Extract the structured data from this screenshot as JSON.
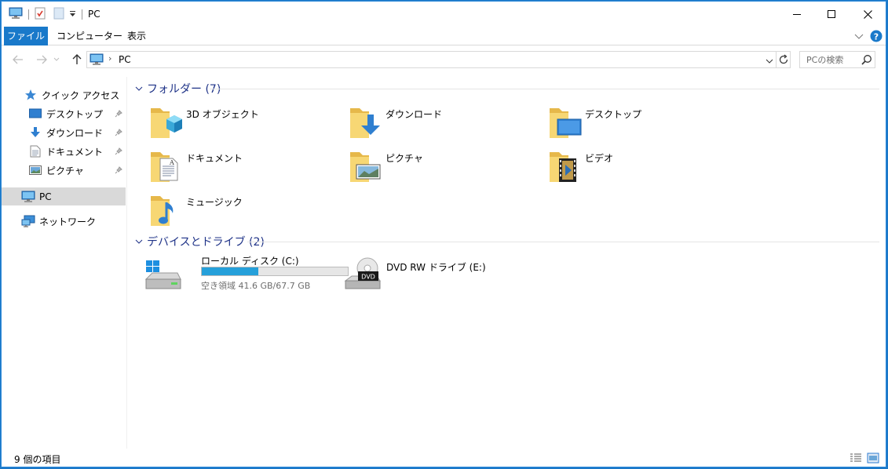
{
  "window": {
    "title": "PC",
    "accent": "#1979ca"
  },
  "ribbon": {
    "tabs": [
      {
        "label": "ファイル"
      },
      {
        "label": "コンピューター"
      },
      {
        "label": "表示"
      }
    ]
  },
  "address": {
    "location": "PC",
    "search_placeholder": "PCの検索"
  },
  "sidebar": {
    "quick_access": "クイック アクセス",
    "items": [
      {
        "label": "デスクトップ",
        "icon": "desktop-icon"
      },
      {
        "label": "ダウンロード",
        "icon": "download-icon"
      },
      {
        "label": "ドキュメント",
        "icon": "document-icon"
      },
      {
        "label": "ピクチャ",
        "icon": "picture-icon"
      }
    ],
    "pc": "PC",
    "network": "ネットワーク"
  },
  "groups": {
    "folders_header": "フォルダー (7)",
    "drives_header": "デバイスとドライブ (2)"
  },
  "folders": [
    {
      "label": "3D オブジェクト",
      "icon": "3d-objects-icon"
    },
    {
      "label": "ダウンロード",
      "icon": "download-icon"
    },
    {
      "label": "デスクトップ",
      "icon": "desktop-icon"
    },
    {
      "label": "ドキュメント",
      "icon": "document-icon"
    },
    {
      "label": "ピクチャ",
      "icon": "picture-icon"
    },
    {
      "label": "ビデオ",
      "icon": "video-icon"
    },
    {
      "label": "ミュージック",
      "icon": "music-icon"
    }
  ],
  "drives": [
    {
      "label": "ローカル ディスク (C:)",
      "free": "空き領域 41.6 GB/67.7 GB",
      "used_fraction": 0.385
    },
    {
      "label": "DVD RW ドライブ (E:)"
    }
  ],
  "status": {
    "item_count": "9 個の項目"
  }
}
